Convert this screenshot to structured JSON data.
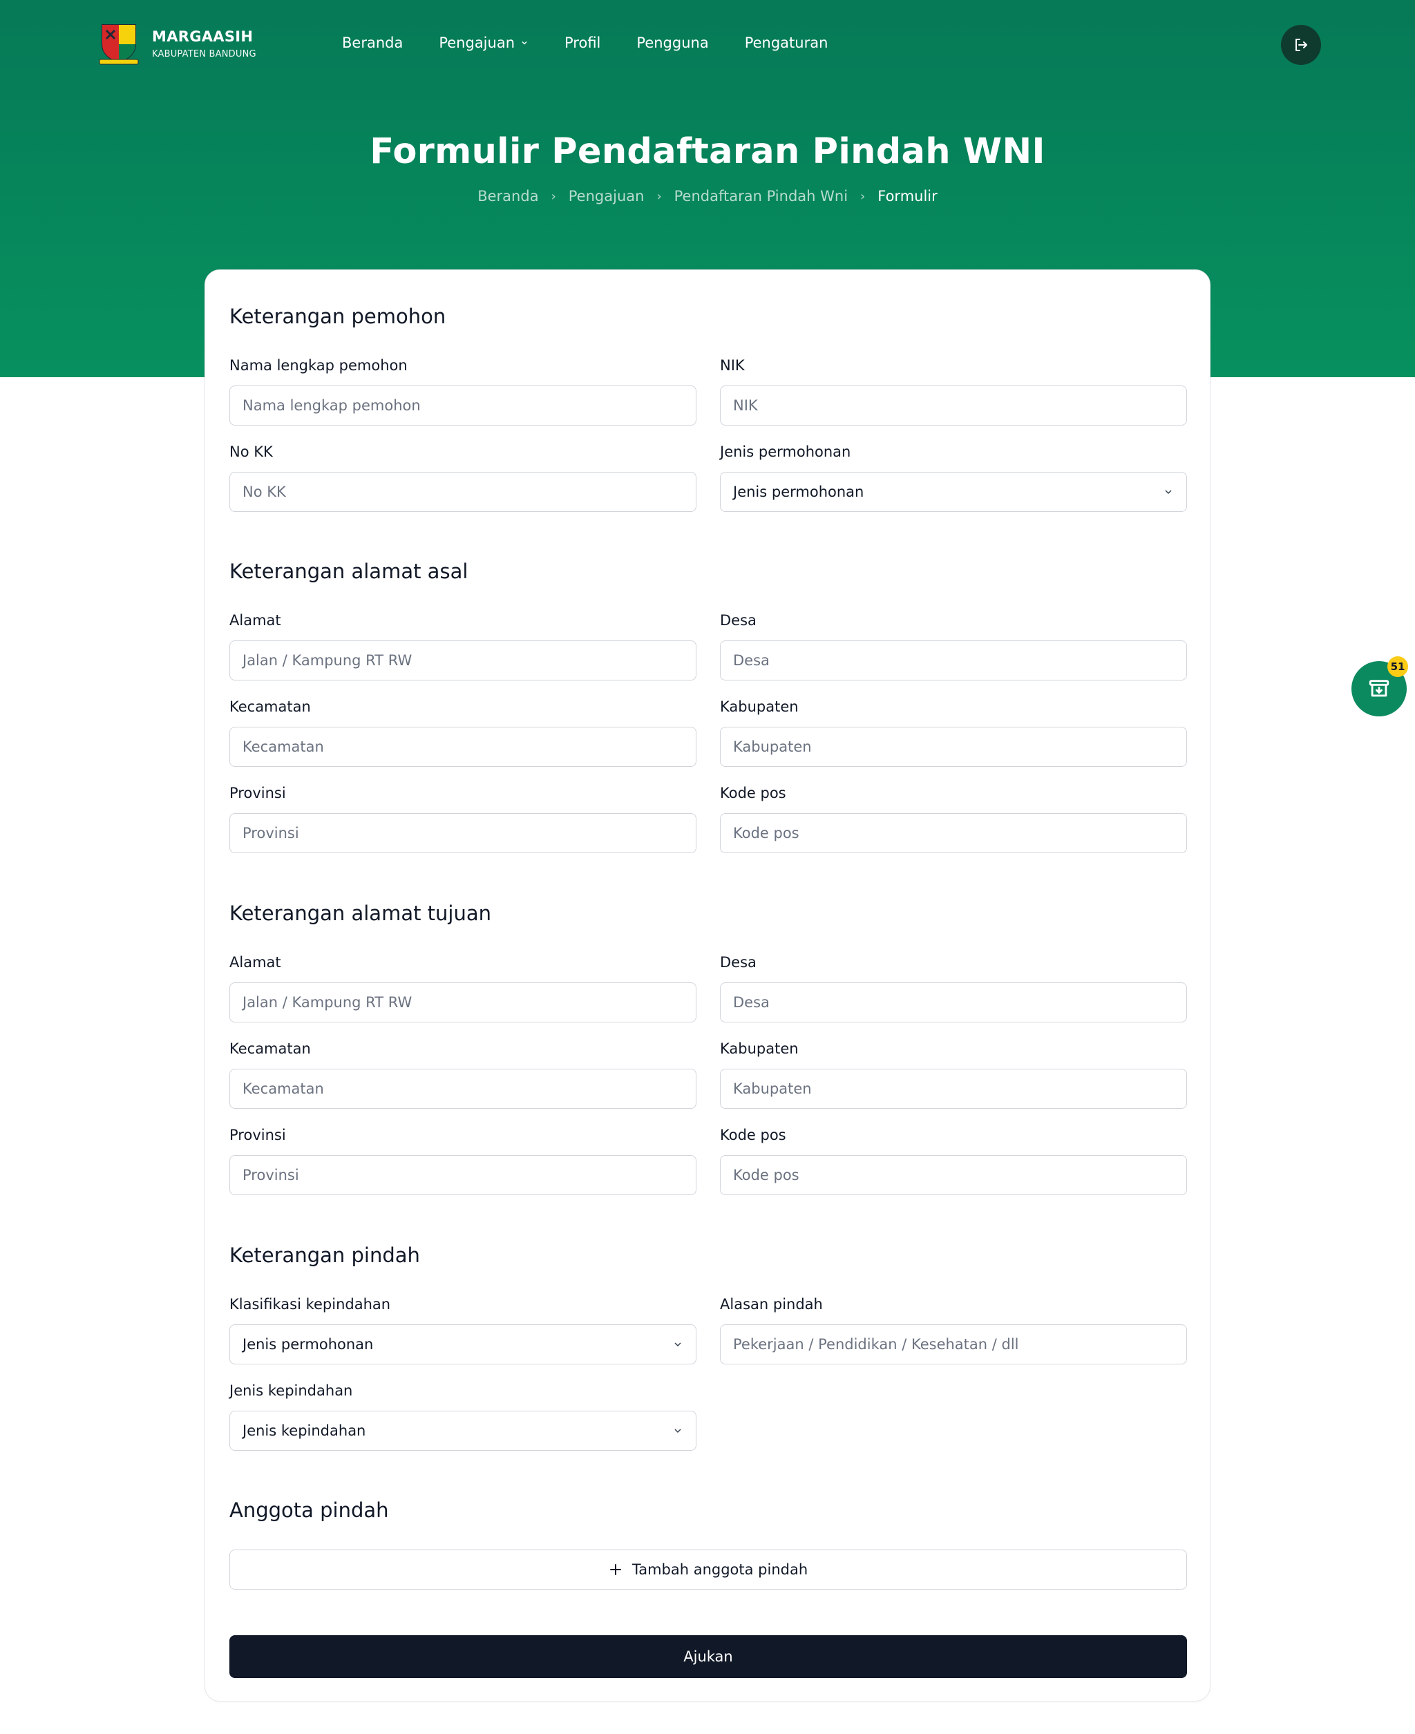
{
  "header": {
    "logo_title": "MARGAASIH",
    "logo_subtitle": "KABUPATEN BANDUNG",
    "nav": [
      {
        "label": "Beranda"
      },
      {
        "label": "Pengajuan"
      },
      {
        "label": "Profil"
      },
      {
        "label": "Pengguna"
      },
      {
        "label": "Pengaturan"
      }
    ],
    "logout_icon": "logout-icon"
  },
  "page": {
    "title": "Formulir Pendaftaran Pindah WNI",
    "breadcrumb": [
      "Beranda",
      "Pengajuan",
      "Pendaftaran Pindah Wni",
      "Formulir"
    ]
  },
  "form": {
    "pemohon": {
      "title": "Keterangan pemohon",
      "nama_label": "Nama lengkap pemohon",
      "nama_placeholder": "Nama lengkap pemohon",
      "nik_label": "NIK",
      "nik_placeholder": "NIK",
      "nokk_label": "No KK",
      "nokk_placeholder": "No KK",
      "jenis_label": "Jenis permohonan",
      "jenis_value": "Jenis permohonan"
    },
    "asal": {
      "title": "Keterangan alamat asal",
      "alamat_label": "Alamat",
      "alamat_placeholder": "Jalan / Kampung RT RW",
      "desa_label": "Desa",
      "desa_placeholder": "Desa",
      "kecamatan_label": "Kecamatan",
      "kecamatan_placeholder": "Kecamatan",
      "kabupaten_label": "Kabupaten",
      "kabupaten_placeholder": "Kabupaten",
      "provinsi_label": "Provinsi",
      "provinsi_placeholder": "Provinsi",
      "kodepos_label": "Kode pos",
      "kodepos_placeholder": "Kode pos"
    },
    "tujuan": {
      "title": "Keterangan alamat tujuan",
      "alamat_label": "Alamat",
      "alamat_placeholder": "Jalan / Kampung RT RW",
      "desa_label": "Desa",
      "desa_placeholder": "Desa",
      "kecamatan_label": "Kecamatan",
      "kecamatan_placeholder": "Kecamatan",
      "kabupaten_label": "Kabupaten",
      "kabupaten_placeholder": "Kabupaten",
      "provinsi_label": "Provinsi",
      "provinsi_placeholder": "Provinsi",
      "kodepos_label": "Kode pos",
      "kodepos_placeholder": "Kode pos"
    },
    "pindah": {
      "title": "Keterangan pindah",
      "klasifikasi_label": "Klasifikasi kepindahan",
      "klasifikasi_value": "Jenis permohonan",
      "alasan_label": "Alasan pindah",
      "alasan_placeholder": "Pekerjaan / Pendidikan / Kesehatan / dll",
      "jenis_label": "Jenis kepindahan",
      "jenis_value": "Jenis kepindahan"
    },
    "anggota": {
      "title": "Anggota pindah",
      "add_label": "Tambah anggota pindah"
    },
    "submit_label": "Ajukan"
  },
  "floating": {
    "badge_count": "51",
    "icon": "archive-download-icon"
  },
  "colors": {
    "hero_top": "#067956",
    "hero_bottom": "#07915f",
    "submit": "#111827",
    "badge": "#facc15"
  }
}
